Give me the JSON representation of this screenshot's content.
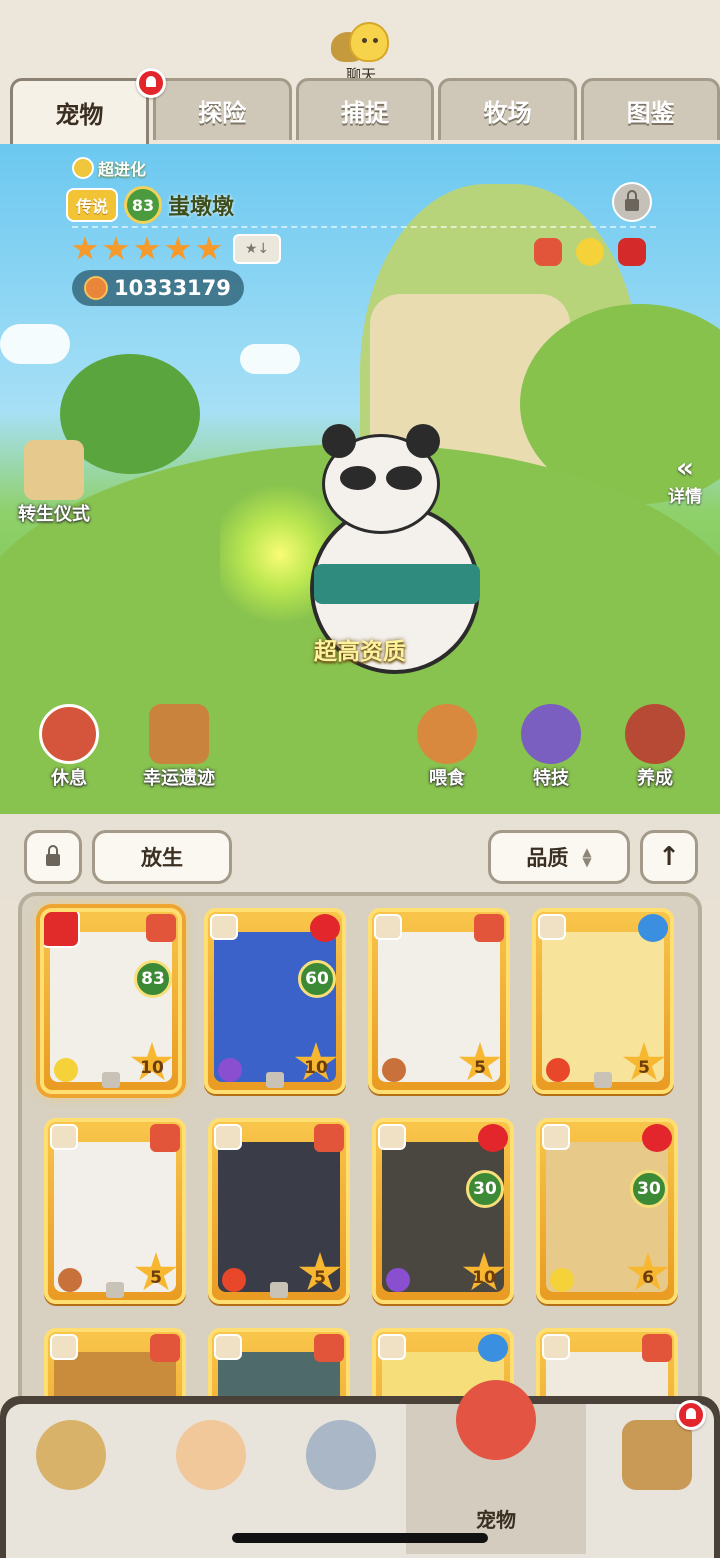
{
  "chat": {
    "label": "聊天"
  },
  "tabs": [
    {
      "label": "宠物",
      "active": true
    },
    {
      "label": "探险"
    },
    {
      "label": "捕捉"
    },
    {
      "label": "牧场"
    },
    {
      "label": "图鉴"
    }
  ],
  "pet": {
    "evolution": "超进化",
    "rarity": "传说",
    "level": "83",
    "name": "蚩墩墩",
    "stars": 5,
    "power": "10333179",
    "quality": "超高资质"
  },
  "scene_buttons": {
    "rebirth": "转生仪式",
    "detail": "详情",
    "rest": "休息",
    "lucky": "幸运遗迹",
    "feed": "喂食",
    "skill": "特技",
    "train": "养成"
  },
  "toolbar": {
    "release": "放生",
    "sort": "品质"
  },
  "cards": [
    {
      "level": "83",
      "stars": "5",
      "star_num": "10"
    },
    {
      "level": "60",
      "star_num": "10"
    },
    {
      "star_num": "5"
    },
    {
      "star_num": "5"
    },
    {
      "star_num": "5"
    },
    {
      "star_num": "5"
    },
    {
      "level": "30",
      "star_num": "10"
    },
    {
      "level": "30",
      "star_num": "6"
    }
  ],
  "bottom_nav": {
    "active_label": "宠物"
  },
  "colors": {
    "tab_active": "#f6f1e6",
    "card_gold": "#f8c54a",
    "level_green": "#3d8a36",
    "alert_red": "#e2262c"
  }
}
